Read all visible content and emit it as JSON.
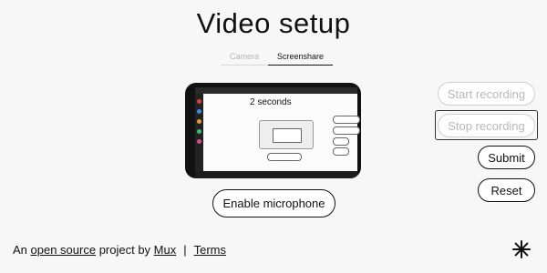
{
  "page": {
    "title": "Video setup"
  },
  "tabs": [
    {
      "label": "Camera",
      "active": false
    },
    {
      "label": "Screenshare",
      "active": true
    }
  ],
  "preview": {
    "recording_title": "2 seconds"
  },
  "microphone": {
    "label": "Enable microphone"
  },
  "controls": {
    "start": "Start recording",
    "stop": "Stop recording",
    "submit": "Submit",
    "reset": "Reset"
  },
  "footer": {
    "prefix": "An ",
    "link_open_source": "open source",
    "middle": " project by ",
    "link_mux": "Mux",
    "separator": "|",
    "link_terms": "Terms"
  },
  "icons": {
    "logo": "mux-burst-icon"
  }
}
